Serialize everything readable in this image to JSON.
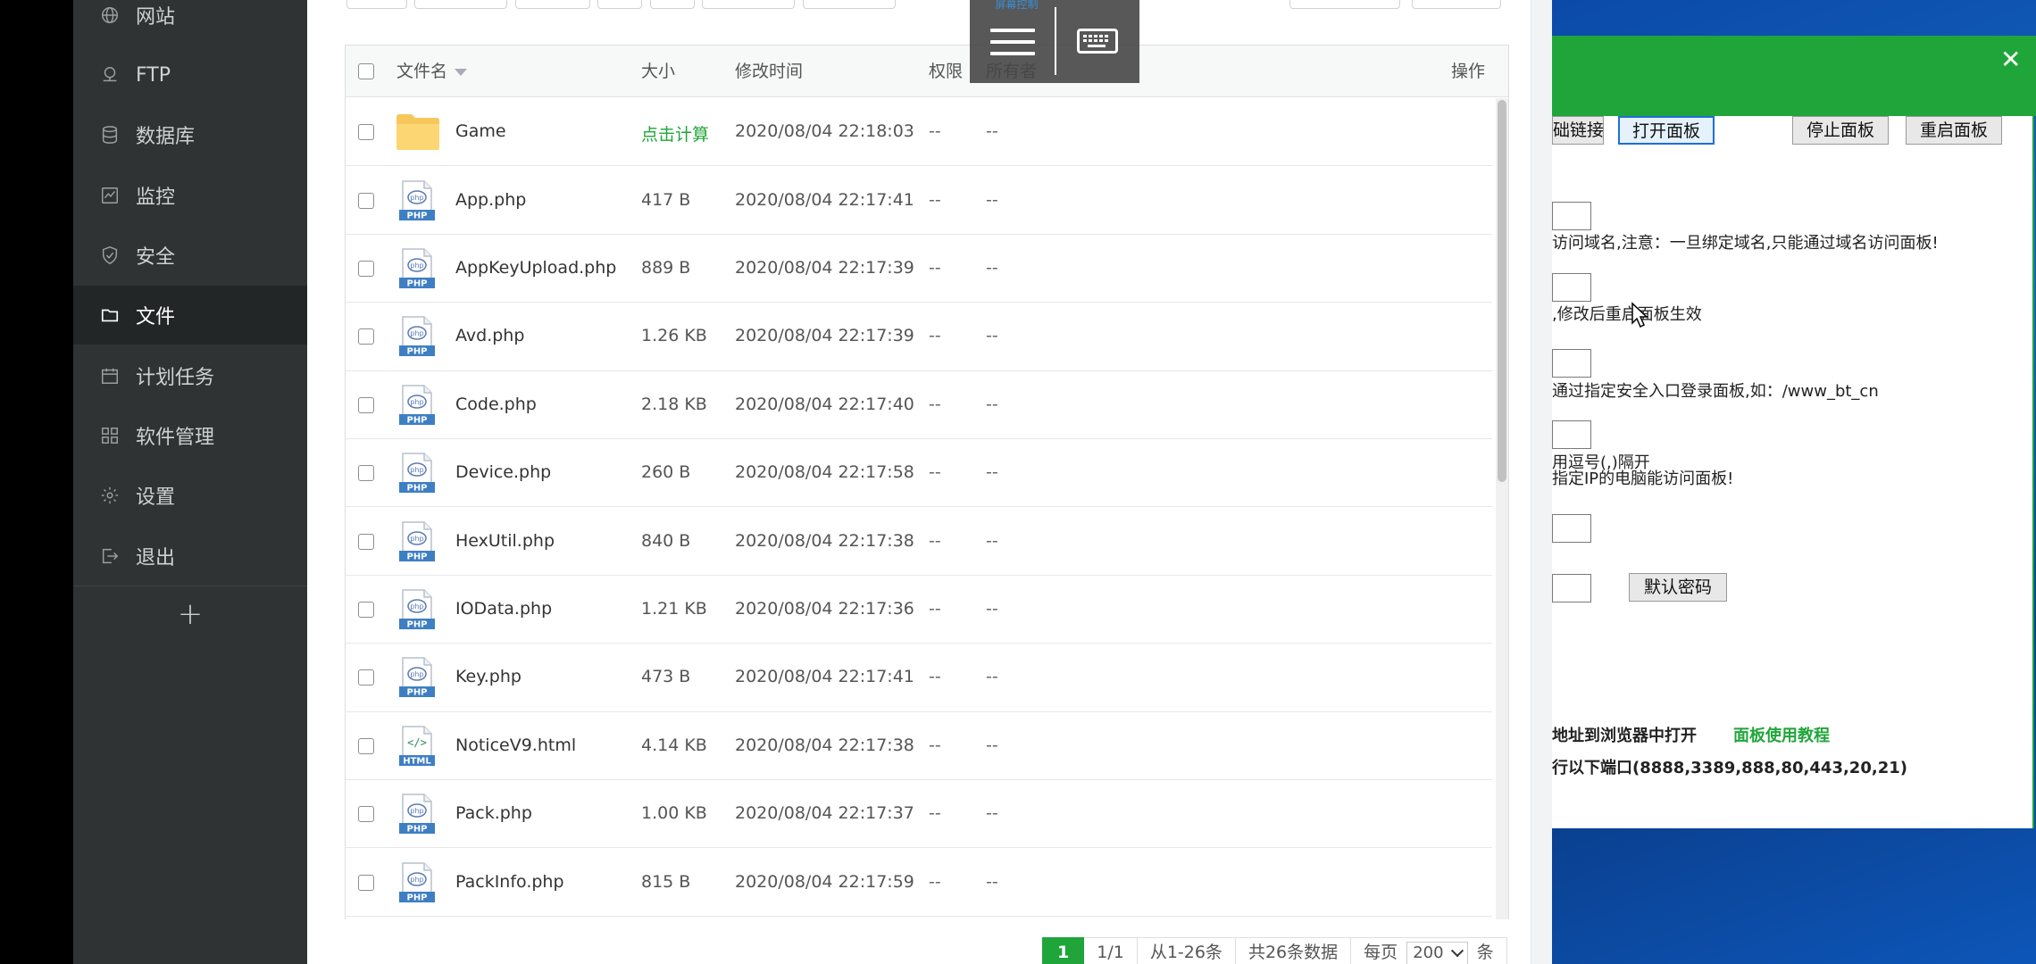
{
  "sidebar": {
    "items": [
      {
        "label": "网站",
        "icon": "globe-icon"
      },
      {
        "label": "FTP",
        "icon": "ftp-icon"
      },
      {
        "label": "数据库",
        "icon": "database-icon"
      },
      {
        "label": "监控",
        "icon": "monitor-icon"
      },
      {
        "label": "安全",
        "icon": "shield-icon"
      },
      {
        "label": "文件",
        "icon": "folder-icon",
        "active": true
      },
      {
        "label": "计划任务",
        "icon": "calendar-icon"
      },
      {
        "label": "软件管理",
        "icon": "apps-icon"
      },
      {
        "label": "设置",
        "icon": "gear-icon"
      },
      {
        "label": "退出",
        "icon": "logout-icon"
      }
    ],
    "add_label": "+"
  },
  "table": {
    "headers": {
      "name": "文件名",
      "size": "大小",
      "mtime": "修改时间",
      "perm": "权限",
      "owner": "所有者",
      "ops": "操作"
    },
    "rows": [
      {
        "type": "folder",
        "name": "Game",
        "size": "点击计算",
        "size_calc": true,
        "mtime": "2020/08/04 22:18:03",
        "perm": "--",
        "owner": "--"
      },
      {
        "type": "php",
        "name": "App.php",
        "size": "417 B",
        "mtime": "2020/08/04 22:17:41",
        "perm": "--",
        "owner": "--"
      },
      {
        "type": "php",
        "name": "AppKeyUpload.php",
        "size": "889 B",
        "mtime": "2020/08/04 22:17:39",
        "perm": "--",
        "owner": "--"
      },
      {
        "type": "php",
        "name": "Avd.php",
        "size": "1.26 KB",
        "mtime": "2020/08/04 22:17:39",
        "perm": "--",
        "owner": "--"
      },
      {
        "type": "php",
        "name": "Code.php",
        "size": "2.18 KB",
        "mtime": "2020/08/04 22:17:40",
        "perm": "--",
        "owner": "--"
      },
      {
        "type": "php",
        "name": "Device.php",
        "size": "260 B",
        "mtime": "2020/08/04 22:17:58",
        "perm": "--",
        "owner": "--"
      },
      {
        "type": "php",
        "name": "HexUtil.php",
        "size": "840 B",
        "mtime": "2020/08/04 22:17:38",
        "perm": "--",
        "owner": "--"
      },
      {
        "type": "php",
        "name": "IOData.php",
        "size": "1.21 KB",
        "mtime": "2020/08/04 22:17:36",
        "perm": "--",
        "owner": "--"
      },
      {
        "type": "php",
        "name": "Key.php",
        "size": "473 B",
        "mtime": "2020/08/04 22:17:41",
        "perm": "--",
        "owner": "--"
      },
      {
        "type": "html",
        "name": "NoticeV9.html",
        "size": "4.14 KB",
        "mtime": "2020/08/04 22:17:38",
        "perm": "--",
        "owner": "--"
      },
      {
        "type": "php",
        "name": "Pack.php",
        "size": "1.00 KB",
        "mtime": "2020/08/04 22:17:37",
        "perm": "--",
        "owner": "--"
      },
      {
        "type": "php",
        "name": "PackInfo.php",
        "size": "815 B",
        "mtime": "2020/08/04 22:17:59",
        "perm": "--",
        "owner": "--"
      }
    ],
    "icon_labels": {
      "php": "PHP",
      "html": "HTML",
      "php_glyph": "php",
      "html_glyph": "</>"
    }
  },
  "pager": {
    "current": "1",
    "pages": "1/1",
    "range": "从1-26条",
    "total": "共26条数据",
    "per_page_label": "每页",
    "per_page": "200",
    "unit": "条"
  },
  "overlay": {
    "title": "屏幕控制"
  },
  "dialog": {
    "close": "✕",
    "buttons": {
      "link": "础链接",
      "open": "打开面板",
      "stop": "停止面板",
      "restart": "重启面板",
      "default_pwd": "默认密码"
    },
    "texts": {
      "domain_note": "访问域名,注意：一旦绑定域名,只能通过域名访问面板!",
      "restart_note": ",修改后重启面板生效",
      "entry_note": "通过指定安全入口登录面板,如：/www_bt_cn",
      "comma_note": "用逗号(,)隔开",
      "ip_note": "指定IP的电脑能访问面板!",
      "browser_note": "地址到浏览器中打开",
      "tutorial": "面板使用教程",
      "ports_note": "行以下端口(8888,3389,888,80,443,20,21)"
    }
  },
  "colors": {
    "brand_green": "#20a53a",
    "sidebar_bg": "#2f3334",
    "sidebar_active": "#232627"
  }
}
